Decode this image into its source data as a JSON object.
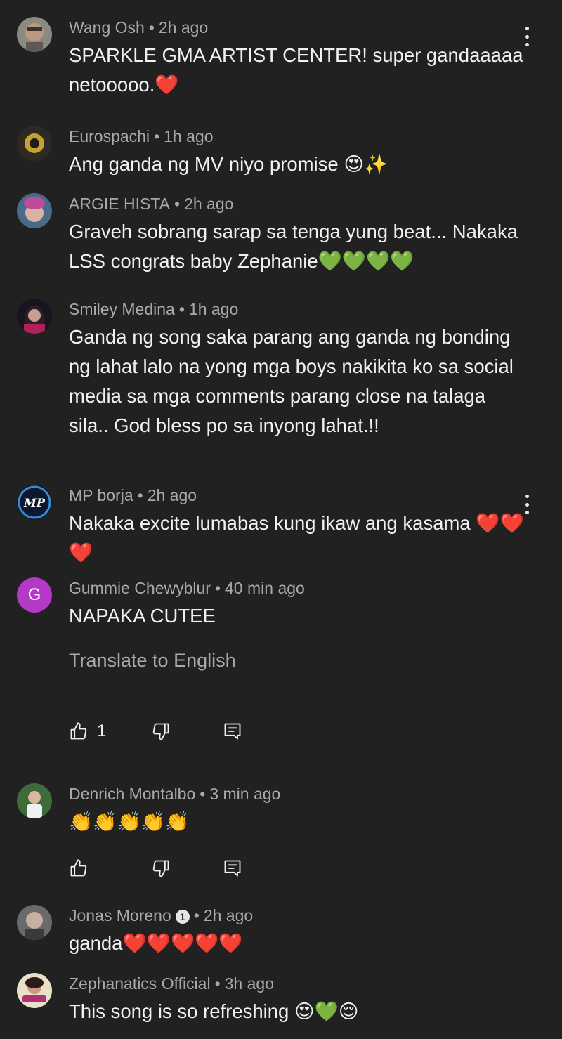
{
  "comments": [
    {
      "author": "Wang Osh",
      "time": "2h ago",
      "text": "SPARKLE GMA ARTIST CENTER! super gandaaaaa netooooo.❤️"
    },
    {
      "author": "Eurospachi",
      "time": "1h ago",
      "text": "Ang ganda ng MV niyo promise 😍✨"
    },
    {
      "author": "ARGIE HISTA",
      "time": "2h ago",
      "text": "Graveh sobrang sarap sa tenga yung beat... Nakaka LSS congrats baby Zephanie💚💚💚💚"
    },
    {
      "author": "Smiley Medina",
      "time": "1h ago",
      "text": "Ganda ng song saka parang ang ganda ng bonding ng lahat lalo na yong mga boys nakikita ko sa social media sa mga comments parang close na talaga sila.. God bless po sa inyong lahat.!!"
    },
    {
      "author": "MP borja",
      "time": "2h ago",
      "text": "Nakaka excite lumabas kung ikaw ang kasama ❤️❤️❤️"
    },
    {
      "author": "Gummie Chewyblur",
      "time": "40 min ago",
      "text": "NAPAKA CUTEE",
      "avatar_letter": "G",
      "translate": "Translate to English",
      "likes": "1"
    },
    {
      "author": "Denrich Montalbo",
      "time": "3 min ago",
      "text": "👏👏👏👏👏"
    },
    {
      "author": "Jonas Moreno",
      "badge": "1",
      "time": "2h ago",
      "text": "ganda❤️❤️❤️❤️❤️"
    },
    {
      "author": "Zephanatics Official",
      "time": "3h ago",
      "text": "This song is so refreshing 😍💚😌"
    }
  ],
  "separator": "•",
  "colors": {
    "background": "#212121",
    "text": "#f1f1f1",
    "meta": "#a9a9a9",
    "avatar_g": "#b339c6"
  },
  "icons": [
    "kebab-menu-icon",
    "thumbs-up-icon",
    "thumbs-down-icon",
    "reply-icon"
  ]
}
